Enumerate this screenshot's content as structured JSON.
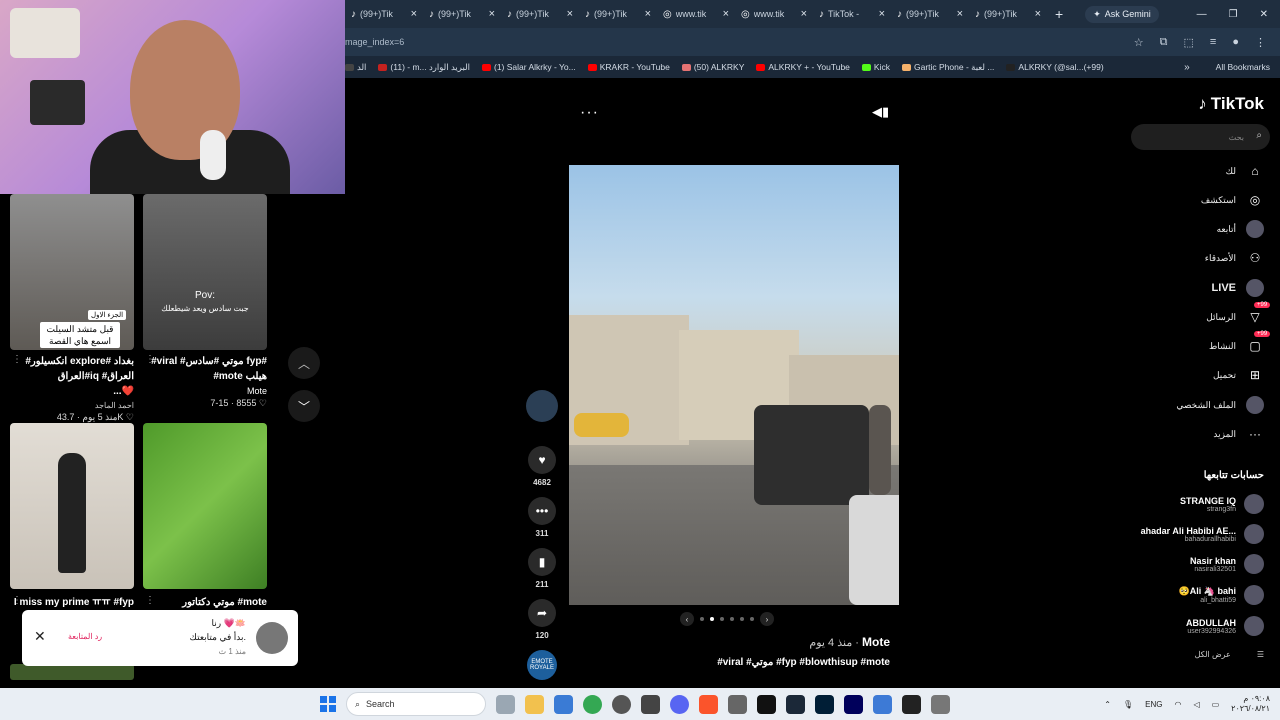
{
  "browser": {
    "tabs": [
      {
        "title": "(99+)Tik",
        "icon": "tiktok-icon"
      },
      {
        "title": "(99+)Tik",
        "icon": "tiktok-icon"
      },
      {
        "title": "(99+)Tik",
        "icon": "tiktok-icon"
      },
      {
        "title": "(99+)Tik",
        "icon": "tiktok-icon"
      },
      {
        "title": "www.tik",
        "icon": "globe-icon"
      },
      {
        "title": "www.tik",
        "icon": "globe-icon"
      },
      {
        "title": "TikTok -",
        "icon": "tiktok-icon"
      },
      {
        "title": "(99+)Tik",
        "icon": "tiktok-icon"
      },
      {
        "title": "(99+)Tik",
        "icon": "tiktok-icon"
      }
    ],
    "new_tab": "+",
    "gemini_label": "Ask Gemini",
    "url": "mage_index=6",
    "bookmarks": [
      {
        "label": "الد",
        "color": "#444"
      },
      {
        "label": "(11) - m... البريد الوارد",
        "color": "#c5221f"
      },
      {
        "label": "(1) Salar Alkrky - Yo...",
        "color": "#ff0000"
      },
      {
        "label": "KRAKR - YouTube",
        "color": "#ff0000"
      },
      {
        "label": "(50) ALKRKY",
        "color": "#e57373"
      },
      {
        "label": "ALKRKY + - YouTube",
        "color": "#ff0000"
      },
      {
        "label": "Kick",
        "color": "#53fc18"
      },
      {
        "label": "Gartic Phone - لعبة ...",
        "color": "#f6b26b"
      },
      {
        "label": "ALKRKY (@sal...(+99)",
        "color": "#222"
      }
    ],
    "bookmarks_more": "»",
    "all_bookmarks": "All Bookmarks"
  },
  "feed": {
    "cards": [
      {
        "caption": "قبل متشد السيلت اسمع هاي القصة",
        "tag": "الجزء الاول",
        "title": "#انكسيلور explore# بغداد #العراقiq #العراق",
        "title2": "...❤️",
        "author": "احمد الماجد",
        "likes": "43.7K",
        "age": "منذ 5 يوم"
      },
      {
        "pov": "Pov:",
        "pov2": "جبت سادس ويعد شيطعلك",
        "title": "#viral #موتي #سادس fyp#",
        "title2": "#mote هيلب",
        "author": "Mote",
        "likes": "8555",
        "age": "7-15"
      },
      {
        "title": "I miss my prime ㅠㅠ #fyp"
      },
      {
        "title": "موتي دكتاتور #mote"
      }
    ],
    "up_arrow": "︿",
    "down_arrow": "﹀"
  },
  "toast": {
    "line1": "رنا 💗🪷",
    "line2": "بدأ في متابعتك.",
    "line3": "منذ 1 ث",
    "follow_back": "رد المتابعة",
    "close": "✕"
  },
  "post": {
    "more": "···",
    "likes": "4682",
    "comments": "311",
    "saves": "211",
    "shares": "120",
    "author": "Mote",
    "time": "منذ 4 يوم",
    "hashtags": "#viral #موتي #fyp #blowthisup #mote",
    "carousel_count": 6,
    "carousel_active": 1,
    "music_label": "EMOTE ROYALE"
  },
  "sidebar": {
    "logo": "TikTok",
    "search_placeholder": "بحث",
    "items": [
      {
        "label": "لك",
        "icon": "home-icon"
      },
      {
        "label": "استكشف",
        "icon": "compass-icon"
      },
      {
        "label": "أتابعه",
        "icon": "following-avatar-icon"
      },
      {
        "label": "الأصدقاء",
        "icon": "friends-icon"
      },
      {
        "label": "LIVE",
        "icon": "live-icon"
      },
      {
        "label": "الرسائل",
        "icon": "messages-icon",
        "badge": "+99"
      },
      {
        "label": "النشاط",
        "icon": "activity-icon",
        "badge": "+99"
      },
      {
        "label": "تحميل",
        "icon": "upload-icon"
      },
      {
        "label": "الملف الشخصي",
        "icon": "profile-icon"
      },
      {
        "label": "المزيد",
        "icon": "more-icon"
      }
    ],
    "following_header": "حسابات تتابعها",
    "accounts": [
      {
        "name": "STRANGE IQ",
        "handle": "strang3fn"
      },
      {
        "name": "ahadar Ali Habibi AE...",
        "handle": "bahadurallhabibi"
      },
      {
        "name": "Nasir khan",
        "handle": "nasirali32501"
      },
      {
        "name": "🥺Ali 🦄 bahi",
        "handle": "ali_bhatti59"
      },
      {
        "name": "ABDULLAH",
        "handle": "user392994326"
      }
    ],
    "show_all": "عرض الكل"
  },
  "taskbar": {
    "search": "Search",
    "lang": "ENG",
    "time": "٠٩:٠٨ م",
    "date": "٢٠٢٦/٠٨/٢١"
  }
}
